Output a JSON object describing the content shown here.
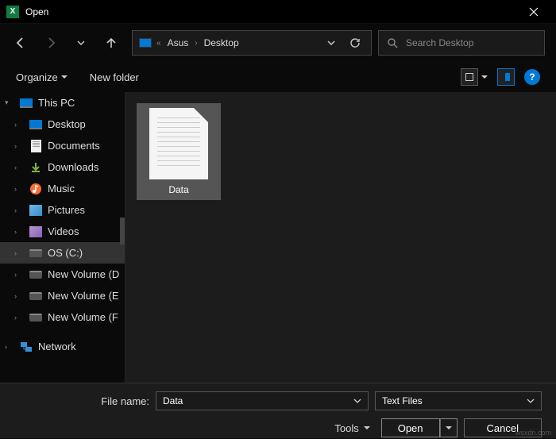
{
  "titlebar": {
    "title": "Open"
  },
  "navbar": {
    "path": [
      "Asus",
      "Desktop"
    ],
    "search_placeholder": "Search Desktop"
  },
  "toolbar": {
    "organize": "Organize",
    "new_folder": "New folder"
  },
  "sidebar": {
    "root": "This PC",
    "items": [
      {
        "label": "Desktop",
        "icon": "monitor"
      },
      {
        "label": "Documents",
        "icon": "doc"
      },
      {
        "label": "Downloads",
        "icon": "dl"
      },
      {
        "label": "Music",
        "icon": "music"
      },
      {
        "label": "Pictures",
        "icon": "pic"
      },
      {
        "label": "Videos",
        "icon": "vid"
      },
      {
        "label": "OS (C:)",
        "icon": "drive",
        "selected": true
      },
      {
        "label": "New Volume (D",
        "icon": "drive"
      },
      {
        "label": "New Volume (E",
        "icon": "drive"
      },
      {
        "label": "New Volume (F",
        "icon": "drive"
      }
    ],
    "network": "Network"
  },
  "content": {
    "files": [
      {
        "name": "Data"
      }
    ]
  },
  "bottom": {
    "file_name_label": "File name:",
    "file_name_value": "Data",
    "file_type": "Text Files",
    "tools": "Tools",
    "open": "Open",
    "cancel": "Cancel"
  },
  "watermark": "wsxdn.com"
}
